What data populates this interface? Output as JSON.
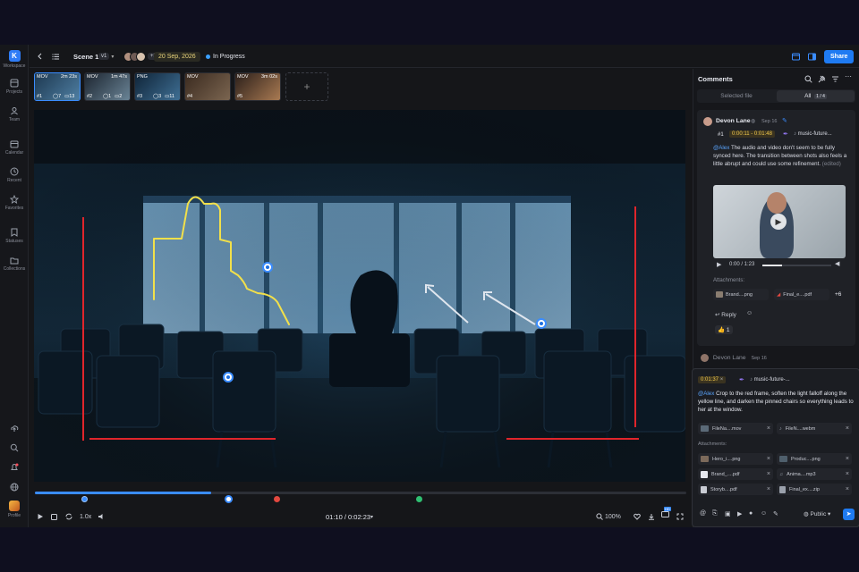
{
  "rail": {
    "items": [
      {
        "label": "Workspace",
        "icon": "workspace-logo-icon",
        "glyph": "K"
      },
      {
        "label": "Projects",
        "icon": "projects-icon"
      },
      {
        "label": "Team",
        "icon": "team-icon"
      },
      {
        "label": "Calendar",
        "icon": "calendar-icon"
      },
      {
        "label": "Recent",
        "icon": "recent-icon"
      },
      {
        "label": "Favorites",
        "icon": "favorites-icon"
      },
      {
        "label": "Statuses",
        "icon": "statuses-icon"
      },
      {
        "label": "Collections",
        "icon": "collections-icon"
      }
    ],
    "profile_label": "Profile"
  },
  "header": {
    "title": "Scene 1",
    "version": "v1",
    "avatar_extra": "+3",
    "date": "20 Sep, 2026",
    "status": "In Progress",
    "status_color": "#3ba0ff",
    "share_label": "Share"
  },
  "thumbnails": [
    {
      "type": "MOV",
      "duration": "2m 23s",
      "index": "#1",
      "views": "7",
      "comments": "13",
      "selected": true
    },
    {
      "type": "MOV",
      "duration": "1m 47s",
      "index": "#2",
      "views": "1",
      "comments": "2",
      "selected": false
    },
    {
      "type": "PNG",
      "duration": "",
      "index": "#3",
      "views": "3",
      "comments": "11",
      "selected": false
    },
    {
      "type": "MOV",
      "duration": "",
      "index": "#4",
      "views": "",
      "comments": "",
      "selected": false
    },
    {
      "type": "MOV",
      "duration": "3m 02s",
      "index": "#5",
      "views": "",
      "comments": "",
      "selected": false
    }
  ],
  "player": {
    "speed": "1.0x",
    "time": "01:10 / 0:02:23",
    "zoom": "100%",
    "progress": 0.27,
    "badge": "HD"
  },
  "comments": {
    "title": "Comments",
    "tab_selected": "Selected file",
    "tab_all": "All",
    "tab_all_count": "1 / 4",
    "thread": {
      "author": "Devon Lane",
      "date": "Sep 16",
      "index": "#1",
      "timerange": "0:00:11 - 0:01:48",
      "file": "music-future...",
      "mention": "@Alex",
      "body": "The audio and video don't seem to be fully synced here. The transition between shots also feels a little abrupt and could use some refinement.",
      "edited": "(edited)",
      "video_time": "0:00 / 1:23",
      "attachments_label": "Attachments:",
      "attachments": [
        "Brand....png",
        "Final_e....pdf"
      ],
      "more": "+6",
      "reply_label": "Reply",
      "reaction": "1"
    },
    "next_author": "Devon Lane",
    "next_date": "Sep 16"
  },
  "composer": {
    "timestamp": "0:01:37",
    "file": "music-future-...",
    "mention": "@Alex",
    "body": "Crop to the red frame, soften the light falloff along the yellow line, and darken the pinned chairs so everything leads to her at the window.",
    "files": [
      "FileNa....mov",
      "FileN....webm"
    ],
    "attachments_label": "Attachments:",
    "attachments": [
      "Hero_i....png",
      "Produc....png",
      "Brand_....pdf",
      "Anima....mp3",
      "Storyb....pdf",
      "Final_ex....zip"
    ],
    "visibility": "Public"
  }
}
